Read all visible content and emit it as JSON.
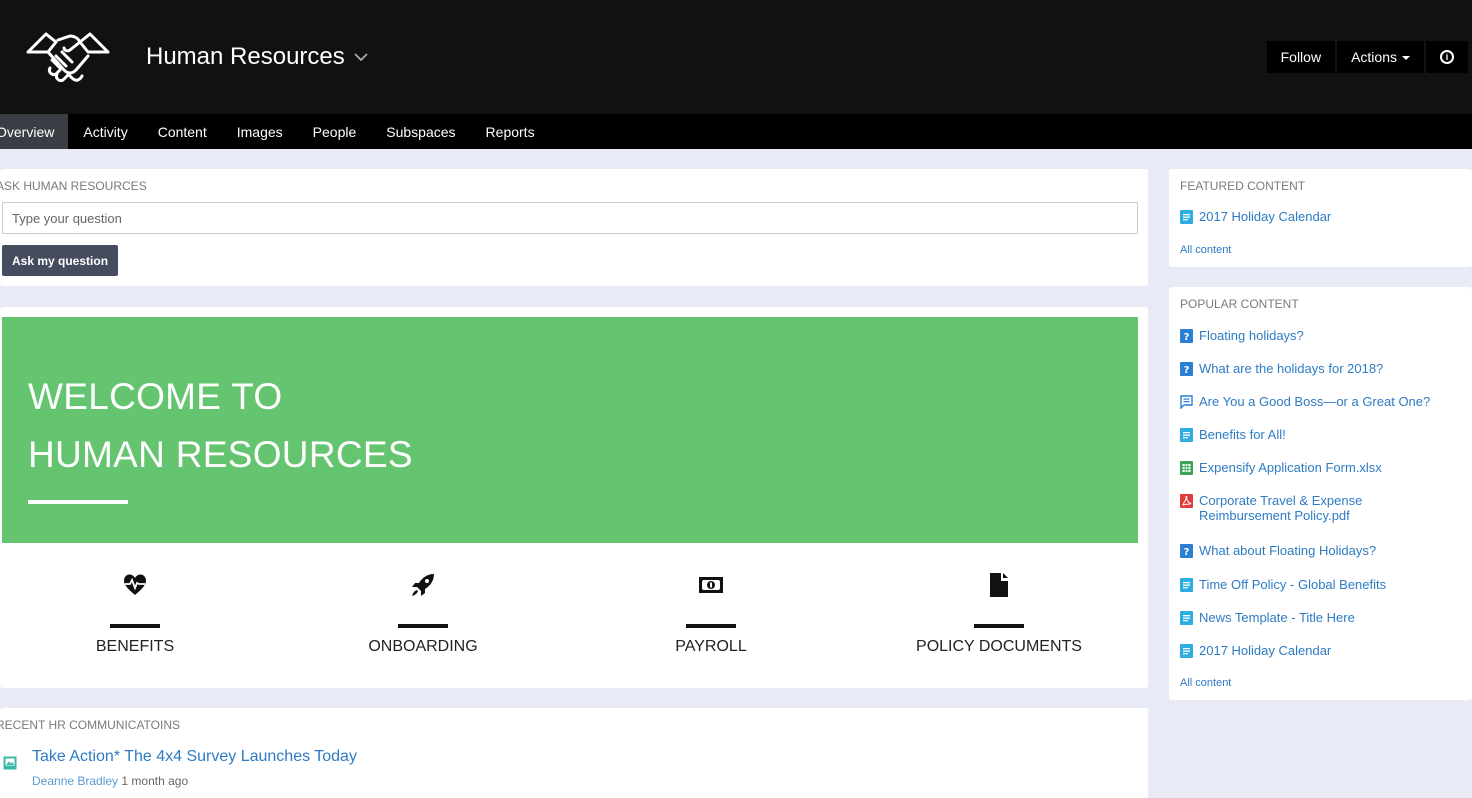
{
  "header": {
    "title": "Human Resources",
    "follow_label": "Follow",
    "actions_label": "Actions",
    "info_glyph": "i"
  },
  "nav": {
    "tabs": [
      {
        "label": "Overview",
        "active": true
      },
      {
        "label": "Activity"
      },
      {
        "label": "Content"
      },
      {
        "label": "Images"
      },
      {
        "label": "People"
      },
      {
        "label": "Subspaces"
      },
      {
        "label": "Reports"
      }
    ]
  },
  "ask": {
    "label": "ASK HUMAN RESOURCES",
    "placeholder": "Type your question",
    "button_label": "Ask my question"
  },
  "welcome": {
    "line1": "WELCOME TO",
    "line2": "HUMAN RESOURCES",
    "hero_color": "#65c46f",
    "links": [
      {
        "label": "BENEFITS",
        "icon": "heartbeat-icon"
      },
      {
        "label": "ONBOARDING",
        "icon": "rocket-icon"
      },
      {
        "label": "PAYROLL",
        "icon": "money-bill-icon"
      },
      {
        "label": "POLICY DOCUMENTS",
        "icon": "document-icon"
      }
    ]
  },
  "recent": {
    "label": "RECENT HR COMMUNICATOINS",
    "item": {
      "title": "Take Action* The 4x4 Survey Launches Today",
      "author": "Deanne Bradley",
      "time": "1 month ago"
    }
  },
  "featured": {
    "label": "FEATURED CONTENT",
    "items": [
      {
        "title": "2017 Holiday Calendar",
        "type": "document"
      }
    ],
    "all_label": "All content"
  },
  "popular": {
    "label": "POPULAR CONTENT",
    "items": [
      {
        "title": "Floating holidays?",
        "type": "question"
      },
      {
        "title": "What are the holidays for 2018?",
        "type": "question"
      },
      {
        "title": "Are You a Good Boss—or a Great One?",
        "type": "discussion"
      },
      {
        "title": "Benefits for All!",
        "type": "document"
      },
      {
        "title": "Expensify Application Form.xlsx",
        "type": "spreadsheet"
      },
      {
        "title": "Corporate Travel & Expense",
        "title2": "Reimbursement Policy.pdf",
        "type": "pdf"
      },
      {
        "title": "What about Floating Holidays?",
        "type": "question"
      },
      {
        "title": "Time Off Policy - Global Benefits",
        "type": "document"
      },
      {
        "title": "News Template - Title Here",
        "type": "document"
      },
      {
        "title": "2017 Holiday Calendar",
        "type": "document"
      }
    ],
    "all_label": "All content"
  },
  "colors": {
    "header_bg": "#111111",
    "nav_bg": "#000000",
    "link": "#2e7bc4",
    "page_bg": "#e8ebf6",
    "button_bg": "#454c5e"
  }
}
